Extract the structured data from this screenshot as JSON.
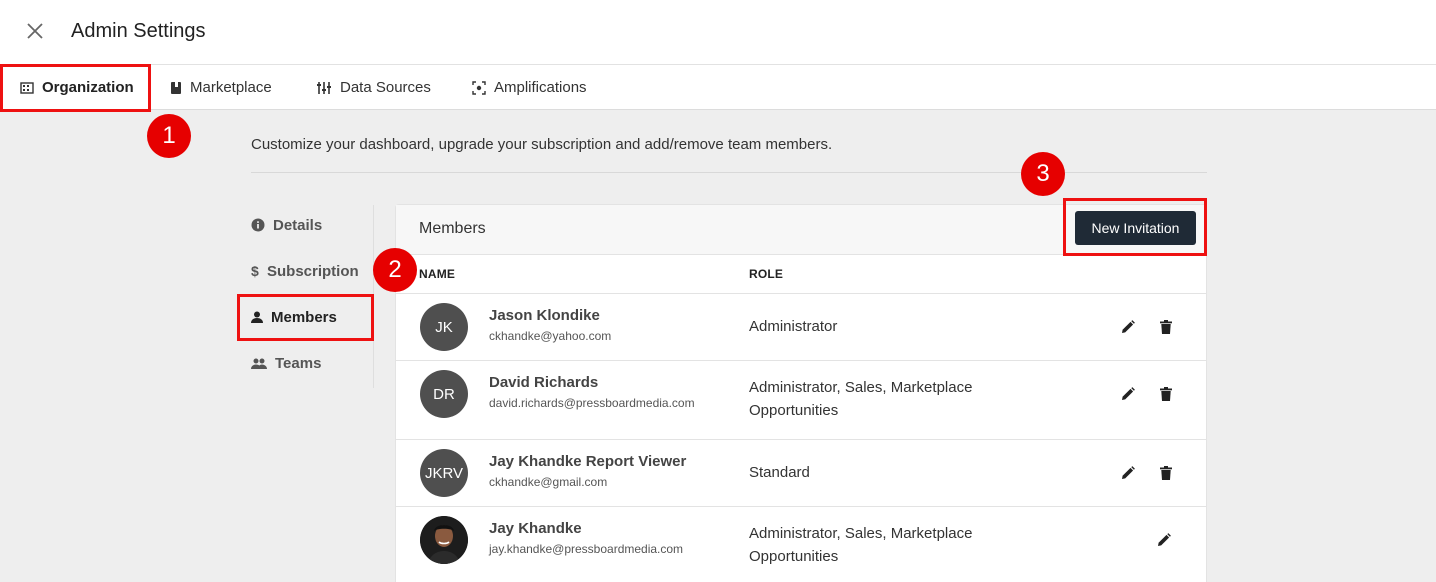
{
  "header": {
    "title": "Admin Settings",
    "close_icon": "close-icon"
  },
  "tabs": [
    {
      "label": "Organization",
      "icon": "building-icon",
      "active": true
    },
    {
      "label": "Marketplace",
      "icon": "book-icon"
    },
    {
      "label": "Data Sources",
      "icon": "sliders-icon"
    },
    {
      "label": "Amplifications",
      "icon": "focus-icon"
    }
  ],
  "subtitle": "Customize your dashboard, upgrade your subscription and add/remove team members.",
  "side_nav": [
    {
      "label": "Details",
      "icon": "info-icon"
    },
    {
      "label": "Subscription",
      "icon": "dollar-icon"
    },
    {
      "label": "Members",
      "icon": "person-icon",
      "active": true
    },
    {
      "label": "Teams",
      "icon": "group-icon"
    }
  ],
  "members": {
    "title": "Members",
    "new_invitation_label": "New Invitation",
    "columns": {
      "name": "NAME",
      "role": "ROLE"
    },
    "rows": [
      {
        "initials": "JK",
        "name": "Jason Klondike",
        "email": "ckhandke@yahoo.com",
        "role": "Administrator"
      },
      {
        "initials": "DR",
        "name": "David Richards",
        "email": "david.richards@pressboardmedia.com",
        "role": "Administrator, Sales, Marketplace Opportunities"
      },
      {
        "initials": "JKRV",
        "name": "Jay Khandke Report Viewer",
        "email": "ckhandke@gmail.com",
        "role": "Standard"
      },
      {
        "initials": "",
        "name": "Jay Khandke",
        "email": "jay.khandke@pressboardmedia.com",
        "role": "Administrator, Sales, Marketplace Opportunities"
      }
    ]
  },
  "annotations": [
    "1",
    "2",
    "3"
  ],
  "colors": {
    "highlight": "#e11111",
    "badge": "#e60000",
    "button": "#1f2a36"
  }
}
